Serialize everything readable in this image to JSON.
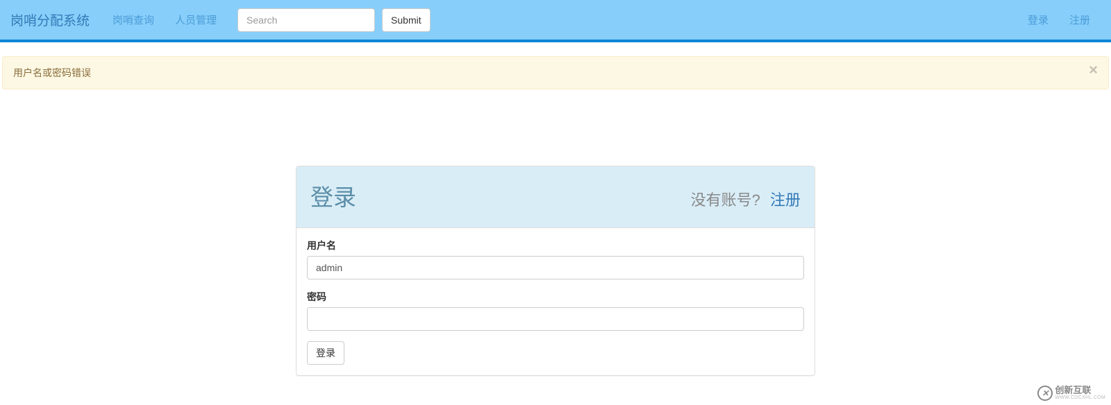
{
  "navbar": {
    "brand": "岗哨分配系统",
    "items": [
      {
        "label": "岗哨查询"
      },
      {
        "label": "人员管理"
      }
    ],
    "search_placeholder": "Search",
    "submit_label": "Submit",
    "right_items": [
      {
        "label": "登录"
      },
      {
        "label": "注册"
      }
    ]
  },
  "alert": {
    "message": "用户名或密码错误",
    "close_label": "×"
  },
  "login": {
    "title": "登录",
    "no_account": "没有账号?",
    "register": "注册",
    "username_label": "用户名",
    "username_value": "admin",
    "password_label": "密码",
    "password_value": "",
    "submit_label": "登录"
  },
  "watermark": {
    "main": "创新互联",
    "sub": "WWW.CDCXHL.COM"
  }
}
